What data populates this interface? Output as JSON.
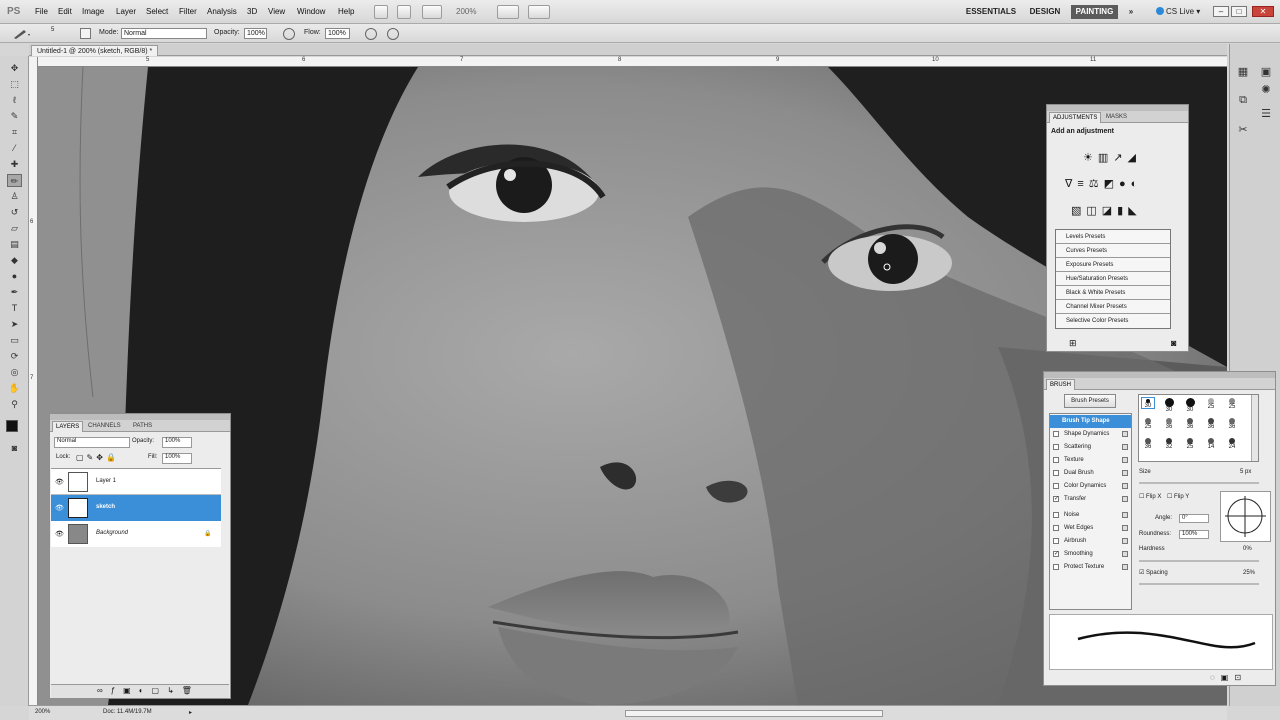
{
  "app": {
    "logo": "PS",
    "menu": [
      "File",
      "Edit",
      "Image",
      "Layer",
      "Select",
      "Filter",
      "Analysis",
      "3D",
      "View",
      "Window",
      "Help"
    ],
    "zoom": "200%",
    "workspaces": [
      "ESSENTIALS",
      "DESIGN",
      "PAINTING"
    ],
    "active_workspace": "PAINTING",
    "cs_live": "CS Live"
  },
  "options": {
    "mode_label": "Mode:",
    "mode": "Normal",
    "opacity_label": "Opacity:",
    "opacity": "100%",
    "flow_label": "Flow:",
    "flow": "100%",
    "brush_size": "5"
  },
  "document": {
    "tab": "Untitled-1 @ 200% (sketch, RGB/8) *",
    "ruler_h": [
      "5",
      "6",
      "7",
      "8",
      "9",
      "10",
      "11"
    ],
    "ruler_v": [
      "6",
      "7"
    ]
  },
  "status": {
    "zoom": "200%",
    "doc": "Doc: 11.4M/19.7M"
  },
  "adjustments": {
    "tabs": [
      "ADJUSTMENTS",
      "MASKS"
    ],
    "title": "Add an adjustment",
    "presets": [
      "Levels Presets",
      "Curves Presets",
      "Exposure Presets",
      "Hue/Saturation Presets",
      "Black & White Presets",
      "Channel Mixer Presets",
      "Selective Color Presets"
    ]
  },
  "brush": {
    "tab": "BRUSH",
    "presets_button": "Brush Presets",
    "items": [
      {
        "label": "Brush Tip Shape",
        "checked": null
      },
      {
        "label": "Shape Dynamics",
        "checked": false
      },
      {
        "label": "Scattering",
        "checked": false
      },
      {
        "label": "Texture",
        "checked": false
      },
      {
        "label": "Dual Brush",
        "checked": false
      },
      {
        "label": "Color Dynamics",
        "checked": false
      },
      {
        "label": "Transfer",
        "checked": true
      },
      {
        "label": "Noise",
        "checked": false
      },
      {
        "label": "Wet Edges",
        "checked": false
      },
      {
        "label": "Airbrush",
        "checked": false
      },
      {
        "label": "Smoothing",
        "checked": true
      },
      {
        "label": "Protect Texture",
        "checked": false
      }
    ],
    "tips": [
      "30",
      "30",
      "30",
      "25",
      "25",
      "25",
      "36",
      "36",
      "36",
      "36",
      "36",
      "32",
      "25",
      "14",
      "24"
    ],
    "size_label": "Size",
    "size": "5 px",
    "flipx": "Flip X",
    "flipy": "Flip Y",
    "angle_label": "Angle:",
    "angle": "0°",
    "roundness_label": "Roundness:",
    "roundness": "100%",
    "hardness_label": "Hardness",
    "hardness": "0%",
    "spacing_label": "Spacing",
    "spacing": "25%"
  },
  "layers": {
    "tabs": [
      "LAYERS",
      "CHANNELS",
      "PATHS"
    ],
    "blend": "Normal",
    "opacity_label": "Opacity:",
    "opacity": "100%",
    "lock_label": "Lock:",
    "fill_label": "Fill:",
    "fill": "100%",
    "items": [
      "Layer 1",
      "sketch",
      "Background"
    ],
    "selected": "sketch",
    "selected_color": "#3b8fd8"
  }
}
